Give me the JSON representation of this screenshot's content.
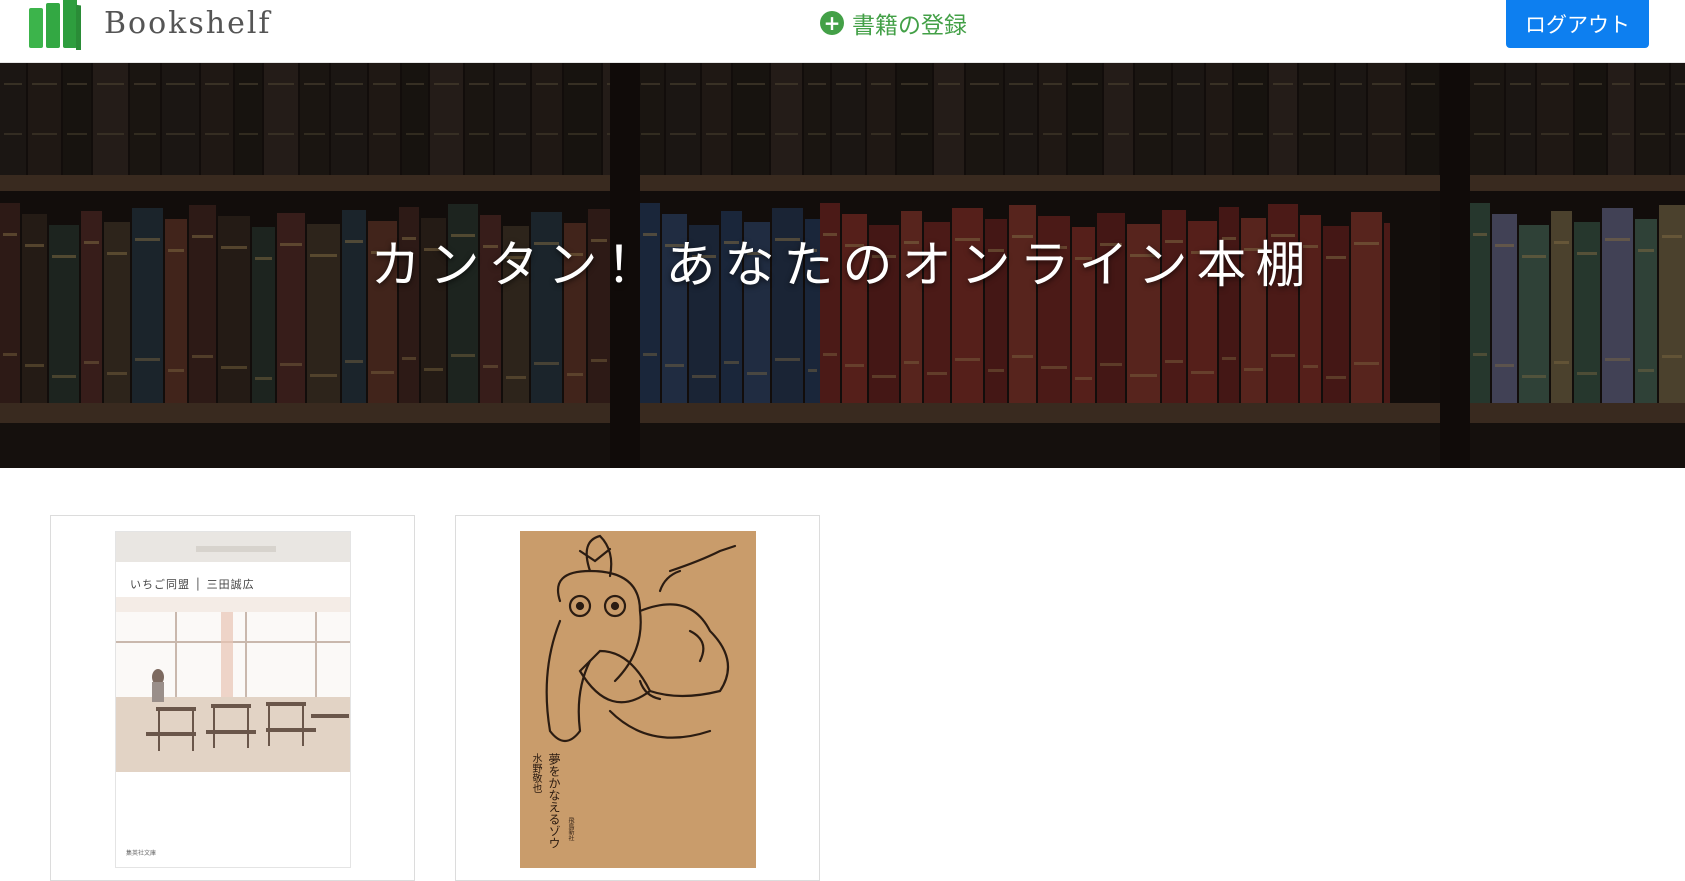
{
  "header": {
    "logo_text": "Bookshelf",
    "logo_icon": "books-icon",
    "register_label": "書籍の登録",
    "register_icon": "plus-circle-icon",
    "logout_label": "ログアウト",
    "accent_green": "#43a047",
    "button_blue": "#0d7ff0"
  },
  "hero": {
    "title": "カンタン！あなたのオンライン本棚"
  },
  "books": [
    {
      "cover_title": "いちご同盟 │ 三田誠広",
      "cover_publisher": "集英社文庫"
    },
    {
      "cover_title": "夢をかなえるゾウ",
      "cover_author": "水野敬也",
      "cover_publisher": "飛鳥新社"
    }
  ]
}
